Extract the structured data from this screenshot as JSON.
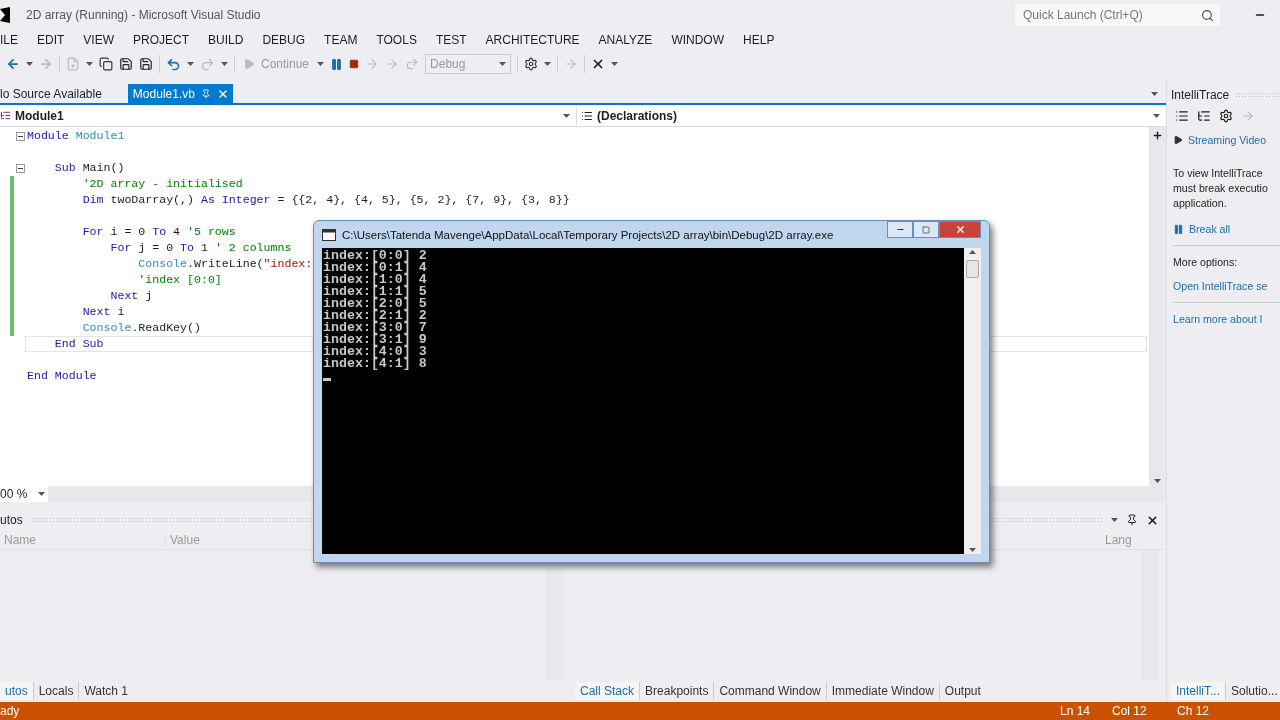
{
  "window": {
    "title": "2D array (Running) - Microsoft Visual Studio",
    "quick_launch": {
      "placeholder": "Quick Launch (Ctrl+Q)"
    }
  },
  "menu": [
    "ILE",
    "EDIT",
    "VIEW",
    "PROJECT",
    "BUILD",
    "DEBUG",
    "TEAM",
    "TOOLS",
    "TEST",
    "ARCHITECTURE",
    "ANALYZE",
    "WINDOW",
    "HELP"
  ],
  "toolbar": {
    "continue": "Continue",
    "configuration": "Debug"
  },
  "document_tabs": [
    {
      "label": "lo Source Available",
      "selected": false
    },
    {
      "label": "Module1.vb",
      "selected": true
    }
  ],
  "editor": {
    "type_dropdown": "Module1",
    "member_dropdown": "(Declarations)",
    "zoom": "00 %",
    "lines": [
      {
        "fold": true,
        "changed": false,
        "current": false,
        "tokens": [
          {
            "kind": "keyword",
            "text": "Module"
          },
          {
            "kind": "type",
            "text": " Module1"
          }
        ]
      },
      {
        "fold": false,
        "changed": false,
        "current": false
      },
      {
        "fold": true,
        "changed": false,
        "current": false,
        "tokens": [
          {
            "kind": "keyword",
            "text": "    Sub"
          },
          {
            "kind": "plain",
            "text": " Main()"
          }
        ]
      },
      {
        "fold": false,
        "changed": true,
        "current": false,
        "tokens": [
          {
            "kind": "comment",
            "text": "        '2D array - initialised"
          }
        ]
      },
      {
        "fold": false,
        "changed": true,
        "current": false,
        "tokens": [
          {
            "kind": "keyword",
            "text": "        Dim"
          },
          {
            "kind": "plain",
            "text": " twoDarray(,) "
          },
          {
            "kind": "keyword",
            "text": "As Integer"
          },
          {
            "kind": "plain",
            "text": " = {{2, 4}, {4, 5}, {5, 2}, {7, 9}, {3, 8}}"
          }
        ]
      },
      {
        "fold": false,
        "changed": true,
        "current": false
      },
      {
        "fold": false,
        "changed": true,
        "current": false,
        "tokens": [
          {
            "kind": "keyword",
            "text": "        For"
          },
          {
            "kind": "plain",
            "text": " i = 0 "
          },
          {
            "kind": "keyword",
            "text": "To"
          },
          {
            "kind": "plain",
            "text": " 4 "
          },
          {
            "kind": "comment",
            "text": "'5 rows"
          }
        ]
      },
      {
        "fold": false,
        "changed": true,
        "current": false,
        "tokens": [
          {
            "kind": "keyword",
            "text": "            For"
          },
          {
            "kind": "plain",
            "text": " j = 0 "
          },
          {
            "kind": "keyword",
            "text": "To"
          },
          {
            "kind": "plain",
            "text": " 1 "
          },
          {
            "kind": "comment",
            "text": "' 2 columns"
          }
        ]
      },
      {
        "fold": false,
        "changed": true,
        "current": false,
        "tokens": [
          {
            "kind": "type",
            "text": "                Console"
          },
          {
            "kind": "plain",
            "text": ".WriteLine("
          },
          {
            "kind": "string",
            "text": "\"index:"
          }
        ]
      },
      {
        "fold": false,
        "changed": true,
        "current": false,
        "tokens": [
          {
            "kind": "comment",
            "text": "                'index [0:0]"
          }
        ]
      },
      {
        "fold": false,
        "changed": true,
        "current": false,
        "tokens": [
          {
            "kind": "keyword",
            "text": "            Next"
          },
          {
            "kind": "plain",
            "text": " j"
          }
        ]
      },
      {
        "fold": false,
        "changed": true,
        "current": false,
        "tokens": [
          {
            "kind": "keyword",
            "text": "        Next"
          },
          {
            "kind": "plain",
            "text": " i"
          }
        ]
      },
      {
        "fold": false,
        "changed": true,
        "current": false,
        "tokens": [
          {
            "kind": "type",
            "text": "        Console"
          },
          {
            "kind": "plain",
            "text": ".ReadKey()"
          }
        ]
      },
      {
        "fold": false,
        "changed": false,
        "current": true,
        "tokens": [
          {
            "kind": "keyword",
            "text": "    End Sub"
          }
        ]
      },
      {
        "fold": false,
        "changed": false,
        "current": false
      },
      {
        "fold": false,
        "changed": false,
        "current": false,
        "tokens": [
          {
            "kind": "keyword",
            "text": "End Module"
          }
        ]
      }
    ]
  },
  "console": {
    "title": "C:\\Users\\Tatenda Mavenge\\AppData\\Local\\Temporary Projects\\2D array\\bin\\Debug\\2D array.exe",
    "lines": [
      "index:[0:0] 2",
      "index:[0:1] 4",
      "index:[1:0] 4",
      "index:[1:1] 5",
      "index:[2:0] 5",
      "index:[2:1] 2",
      "index:[3:0] 7",
      "index:[3:1] 9",
      "index:[4:0] 3",
      "index:[4:1] 8"
    ]
  },
  "autos_panel": {
    "title": "utos",
    "columns": [
      "Name",
      "Value"
    ],
    "tabs": [
      {
        "label": "utos",
        "selected": true
      },
      {
        "label": "Locals",
        "selected": false
      },
      {
        "label": "Watch 1",
        "selected": false
      }
    ]
  },
  "call_stack_panel": {
    "columns": [
      "Lang"
    ],
    "tabs": [
      {
        "label": "Call Stack",
        "selected": true
      },
      {
        "label": "Breakpoints",
        "selected": false
      },
      {
        "label": "Command Window",
        "selected": false
      },
      {
        "label": "Immediate Window",
        "selected": false
      },
      {
        "label": "Output",
        "selected": false
      }
    ]
  },
  "intellitrace": {
    "title": "IntelliTrace",
    "video_link": "Streaming Video",
    "message": [
      "To view IntelliTrace",
      "must break executio",
      "application."
    ],
    "break_all": "Break all",
    "more_options": "More options:",
    "links": [
      "Open IntelliTrace se",
      "Learn more about I"
    ],
    "tabs": [
      {
        "label": "IntelliT...",
        "selected": true
      },
      {
        "label": "Solutio...",
        "selected": false
      }
    ]
  },
  "status_bar": {
    "message": "ady",
    "line": "Ln 14",
    "column": "Col 12",
    "char": "Ch 12"
  }
}
